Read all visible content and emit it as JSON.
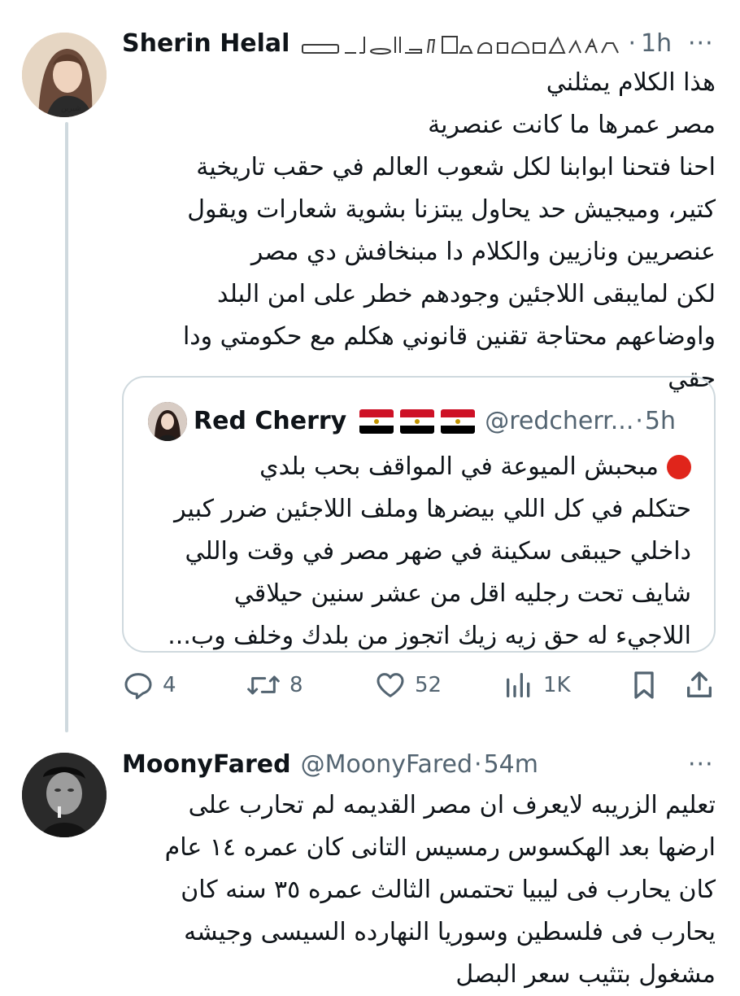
{
  "tweet1": {
    "name": "Sherin Helal",
    "dot": "·",
    "time": "1h",
    "more": "···",
    "lines": [
      "هذا الكلام يمثلني",
      "مصر عمرها ما كانت عنصرية",
      "احنا فتحنا ابوابنا لكل شعوب العالم في حقب تاريخية",
      "كتير، وميجيش حد يحاول يبتزنا بشوية شعارات ويقول",
      "عنصريين ونازيين والكلام دا مبنخافش دي مصر",
      "لكن لمايبقى اللاجئين وجودهم خطر على امن البلد",
      "واوضاعهم محتاجة تقنين قانوني هكلم مع حكومتي ودا",
      "حقي"
    ],
    "quote": {
      "name": "Red Cherry",
      "handle": "@redcherr...",
      "dot": "·",
      "time": "5h",
      "lines": [
        "مبحبش الميوعة في المواقف بحب بلدي",
        "حتكلم في كل اللي بيضرها وملف اللاجئين ضرر كبير",
        "داخلي حيبقى سكينة في ضهر مصر في وقت واللي",
        "شايف تحت رجليه اقل من عشر سنين حيلاقي",
        "اللاجيء له حق زيه زيك اتجوز من بلدك وخلف وب..."
      ]
    },
    "actions": {
      "replies": "4",
      "retweets": "8",
      "likes": "52",
      "views": "1K"
    }
  },
  "tweet2": {
    "name": "MoonyFared",
    "handle": "@MoonyFared",
    "dot": "·",
    "time": "54m",
    "more": "···",
    "lines": [
      "تعليم الزريبه لايعرف ان مصر القديمه لم تحارب على",
      "ارضها بعد الهكسوس رمسيس التانى كان عمره ١٤ عام",
      "كان يحارب فى ليبيا تحتمس الثالث عمره ٣٥ سنه كان",
      "يحارب فى فلسطين وسوريا النهارده السيسى وجيشه",
      "مشغول بتثيب سعر البصل"
    ]
  },
  "colors": {
    "text": "#0f1419",
    "secondary": "#536471",
    "border": "#cfd9de",
    "red": "#e0251b"
  }
}
